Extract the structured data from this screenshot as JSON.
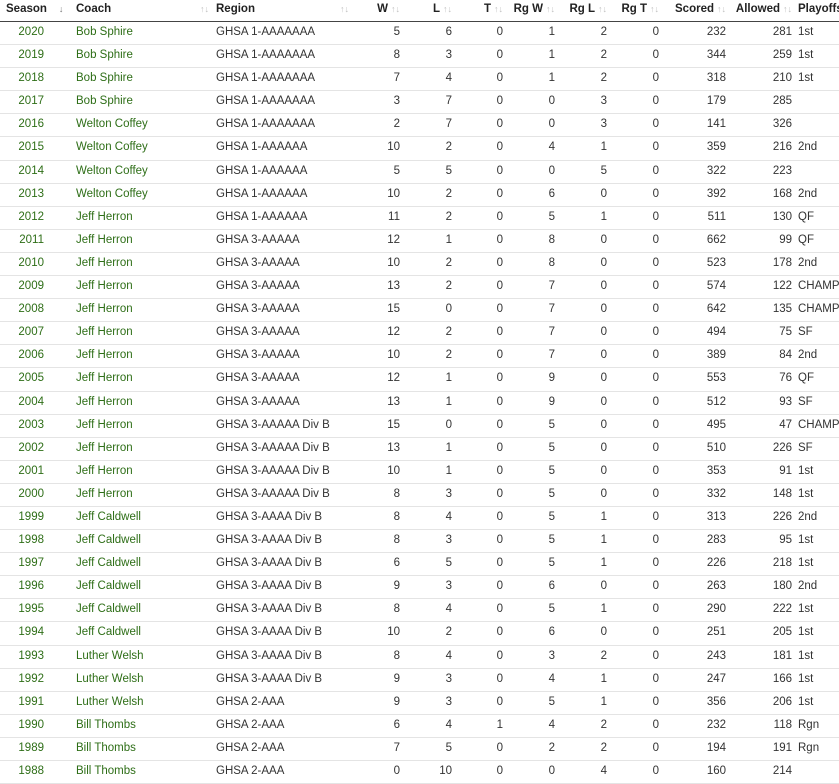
{
  "columns": {
    "season": "Season",
    "coach": "Coach",
    "region": "Region",
    "w": "W",
    "l": "L",
    "t": "T",
    "rgw": "Rg W",
    "rgl": "Rg L",
    "rgt": "Rg T",
    "scored": "Scored",
    "allowed": "Allowed",
    "playoffs": "Playoffs"
  },
  "sort_icons": {
    "active": "↓",
    "inactive": "↑↓"
  },
  "colors": {
    "link": "#2e6e17",
    "header_border": "#444444",
    "row_border": "#e4e4e4"
  },
  "rows": [
    {
      "season": "2020",
      "coach": "Bob Sphire",
      "region": "GHSA 1-AAAAAAA",
      "w": "5",
      "l": "6",
      "t": "0",
      "rgw": "1",
      "rgl": "2",
      "rgt": "0",
      "scored": "232",
      "allowed": "281",
      "playoffs": "1st"
    },
    {
      "season": "2019",
      "coach": "Bob Sphire",
      "region": "GHSA 1-AAAAAAA",
      "w": "8",
      "l": "3",
      "t": "0",
      "rgw": "1",
      "rgl": "2",
      "rgt": "0",
      "scored": "344",
      "allowed": "259",
      "playoffs": "1st"
    },
    {
      "season": "2018",
      "coach": "Bob Sphire",
      "region": "GHSA 1-AAAAAAA",
      "w": "7",
      "l": "4",
      "t": "0",
      "rgw": "1",
      "rgl": "2",
      "rgt": "0",
      "scored": "318",
      "allowed": "210",
      "playoffs": "1st"
    },
    {
      "season": "2017",
      "coach": "Bob Sphire",
      "region": "GHSA 1-AAAAAAA",
      "w": "3",
      "l": "7",
      "t": "0",
      "rgw": "0",
      "rgl": "3",
      "rgt": "0",
      "scored": "179",
      "allowed": "285",
      "playoffs": ""
    },
    {
      "season": "2016",
      "coach": "Welton Coffey",
      "region": "GHSA 1-AAAAAAA",
      "w": "2",
      "l": "7",
      "t": "0",
      "rgw": "0",
      "rgl": "3",
      "rgt": "0",
      "scored": "141",
      "allowed": "326",
      "playoffs": ""
    },
    {
      "season": "2015",
      "coach": "Welton Coffey",
      "region": "GHSA 1-AAAAAA",
      "w": "10",
      "l": "2",
      "t": "0",
      "rgw": "4",
      "rgl": "1",
      "rgt": "0",
      "scored": "359",
      "allowed": "216",
      "playoffs": "2nd"
    },
    {
      "season": "2014",
      "coach": "Welton Coffey",
      "region": "GHSA 1-AAAAAA",
      "w": "5",
      "l": "5",
      "t": "0",
      "rgw": "0",
      "rgl": "5",
      "rgt": "0",
      "scored": "322",
      "allowed": "223",
      "playoffs": ""
    },
    {
      "season": "2013",
      "coach": "Welton Coffey",
      "region": "GHSA 1-AAAAAA",
      "w": "10",
      "l": "2",
      "t": "0",
      "rgw": "6",
      "rgl": "0",
      "rgt": "0",
      "scored": "392",
      "allowed": "168",
      "playoffs": "2nd"
    },
    {
      "season": "2012",
      "coach": "Jeff Herron",
      "region": "GHSA 1-AAAAAA",
      "w": "11",
      "l": "2",
      "t": "0",
      "rgw": "5",
      "rgl": "1",
      "rgt": "0",
      "scored": "511",
      "allowed": "130",
      "playoffs": "QF"
    },
    {
      "season": "2011",
      "coach": "Jeff Herron",
      "region": "GHSA 3-AAAAA",
      "w": "12",
      "l": "1",
      "t": "0",
      "rgw": "8",
      "rgl": "0",
      "rgt": "0",
      "scored": "662",
      "allowed": "99",
      "playoffs": "QF"
    },
    {
      "season": "2010",
      "coach": "Jeff Herron",
      "region": "GHSA 3-AAAAA",
      "w": "10",
      "l": "2",
      "t": "0",
      "rgw": "8",
      "rgl": "0",
      "rgt": "0",
      "scored": "523",
      "allowed": "178",
      "playoffs": "2nd"
    },
    {
      "season": "2009",
      "coach": "Jeff Herron",
      "region": "GHSA 3-AAAAA",
      "w": "13",
      "l": "2",
      "t": "0",
      "rgw": "7",
      "rgl": "0",
      "rgt": "0",
      "scored": "574",
      "allowed": "122",
      "playoffs": "CHAMP"
    },
    {
      "season": "2008",
      "coach": "Jeff Herron",
      "region": "GHSA 3-AAAAA",
      "w": "15",
      "l": "0",
      "t": "0",
      "rgw": "7",
      "rgl": "0",
      "rgt": "0",
      "scored": "642",
      "allowed": "135",
      "playoffs": "CHAMP"
    },
    {
      "season": "2007",
      "coach": "Jeff Herron",
      "region": "GHSA 3-AAAAA",
      "w": "12",
      "l": "2",
      "t": "0",
      "rgw": "7",
      "rgl": "0",
      "rgt": "0",
      "scored": "494",
      "allowed": "75",
      "playoffs": "SF"
    },
    {
      "season": "2006",
      "coach": "Jeff Herron",
      "region": "GHSA 3-AAAAA",
      "w": "10",
      "l": "2",
      "t": "0",
      "rgw": "7",
      "rgl": "0",
      "rgt": "0",
      "scored": "389",
      "allowed": "84",
      "playoffs": "2nd"
    },
    {
      "season": "2005",
      "coach": "Jeff Herron",
      "region": "GHSA 3-AAAAA",
      "w": "12",
      "l": "1",
      "t": "0",
      "rgw": "9",
      "rgl": "0",
      "rgt": "0",
      "scored": "553",
      "allowed": "76",
      "playoffs": "QF"
    },
    {
      "season": "2004",
      "coach": "Jeff Herron",
      "region": "GHSA 3-AAAAA",
      "w": "13",
      "l": "1",
      "t": "0",
      "rgw": "9",
      "rgl": "0",
      "rgt": "0",
      "scored": "512",
      "allowed": "93",
      "playoffs": "SF"
    },
    {
      "season": "2003",
      "coach": "Jeff Herron",
      "region": "GHSA 3-AAAAA Div B",
      "w": "15",
      "l": "0",
      "t": "0",
      "rgw": "5",
      "rgl": "0",
      "rgt": "0",
      "scored": "495",
      "allowed": "47",
      "playoffs": "CHAMP"
    },
    {
      "season": "2002",
      "coach": "Jeff Herron",
      "region": "GHSA 3-AAAAA Div B",
      "w": "13",
      "l": "1",
      "t": "0",
      "rgw": "5",
      "rgl": "0",
      "rgt": "0",
      "scored": "510",
      "allowed": "226",
      "playoffs": "SF"
    },
    {
      "season": "2001",
      "coach": "Jeff Herron",
      "region": "GHSA 3-AAAAA Div B",
      "w": "10",
      "l": "1",
      "t": "0",
      "rgw": "5",
      "rgl": "0",
      "rgt": "0",
      "scored": "353",
      "allowed": "91",
      "playoffs": "1st"
    },
    {
      "season": "2000",
      "coach": "Jeff Herron",
      "region": "GHSA 3-AAAAA Div B",
      "w": "8",
      "l": "3",
      "t": "0",
      "rgw": "5",
      "rgl": "0",
      "rgt": "0",
      "scored": "332",
      "allowed": "148",
      "playoffs": "1st"
    },
    {
      "season": "1999",
      "coach": "Jeff Caldwell",
      "region": "GHSA 3-AAAA Div B",
      "w": "8",
      "l": "4",
      "t": "0",
      "rgw": "5",
      "rgl": "1",
      "rgt": "0",
      "scored": "313",
      "allowed": "226",
      "playoffs": "2nd"
    },
    {
      "season": "1998",
      "coach": "Jeff Caldwell",
      "region": "GHSA 3-AAAA Div B",
      "w": "8",
      "l": "3",
      "t": "0",
      "rgw": "5",
      "rgl": "1",
      "rgt": "0",
      "scored": "283",
      "allowed": "95",
      "playoffs": "1st"
    },
    {
      "season": "1997",
      "coach": "Jeff Caldwell",
      "region": "GHSA 3-AAAA Div B",
      "w": "6",
      "l": "5",
      "t": "0",
      "rgw": "5",
      "rgl": "1",
      "rgt": "0",
      "scored": "226",
      "allowed": "218",
      "playoffs": "1st"
    },
    {
      "season": "1996",
      "coach": "Jeff Caldwell",
      "region": "GHSA 3-AAAA Div B",
      "w": "9",
      "l": "3",
      "t": "0",
      "rgw": "6",
      "rgl": "0",
      "rgt": "0",
      "scored": "263",
      "allowed": "180",
      "playoffs": "2nd"
    },
    {
      "season": "1995",
      "coach": "Jeff Caldwell",
      "region": "GHSA 3-AAAA Div B",
      "w": "8",
      "l": "4",
      "t": "0",
      "rgw": "5",
      "rgl": "1",
      "rgt": "0",
      "scored": "290",
      "allowed": "222",
      "playoffs": "1st"
    },
    {
      "season": "1994",
      "coach": "Jeff Caldwell",
      "region": "GHSA 3-AAAA Div B",
      "w": "10",
      "l": "2",
      "t": "0",
      "rgw": "6",
      "rgl": "0",
      "rgt": "0",
      "scored": "251",
      "allowed": "205",
      "playoffs": "1st"
    },
    {
      "season": "1993",
      "coach": "Luther Welsh",
      "region": "GHSA 3-AAAA Div B",
      "w": "8",
      "l": "4",
      "t": "0",
      "rgw": "3",
      "rgl": "2",
      "rgt": "0",
      "scored": "243",
      "allowed": "181",
      "playoffs": "1st"
    },
    {
      "season": "1992",
      "coach": "Luther Welsh",
      "region": "GHSA 3-AAAA Div B",
      "w": "9",
      "l": "3",
      "t": "0",
      "rgw": "4",
      "rgl": "1",
      "rgt": "0",
      "scored": "247",
      "allowed": "166",
      "playoffs": "1st"
    },
    {
      "season": "1991",
      "coach": "Luther Welsh",
      "region": "GHSA 2-AAA",
      "w": "9",
      "l": "3",
      "t": "0",
      "rgw": "5",
      "rgl": "1",
      "rgt": "0",
      "scored": "356",
      "allowed": "206",
      "playoffs": "1st"
    },
    {
      "season": "1990",
      "coach": "Bill Thombs",
      "region": "GHSA 2-AAA",
      "w": "6",
      "l": "4",
      "t": "1",
      "rgw": "4",
      "rgl": "2",
      "rgt": "0",
      "scored": "232",
      "allowed": "118",
      "playoffs": "Rgn"
    },
    {
      "season": "1989",
      "coach": "Bill Thombs",
      "region": "GHSA 2-AAA",
      "w": "7",
      "l": "5",
      "t": "0",
      "rgw": "2",
      "rgl": "2",
      "rgt": "0",
      "scored": "194",
      "allowed": "191",
      "playoffs": "Rgn"
    },
    {
      "season": "1988",
      "coach": "Bill Thombs",
      "region": "GHSA 2-AAA",
      "w": "0",
      "l": "10",
      "t": "0",
      "rgw": "0",
      "rgl": "4",
      "rgt": "0",
      "scored": "160",
      "allowed": "214",
      "playoffs": ""
    }
  ]
}
